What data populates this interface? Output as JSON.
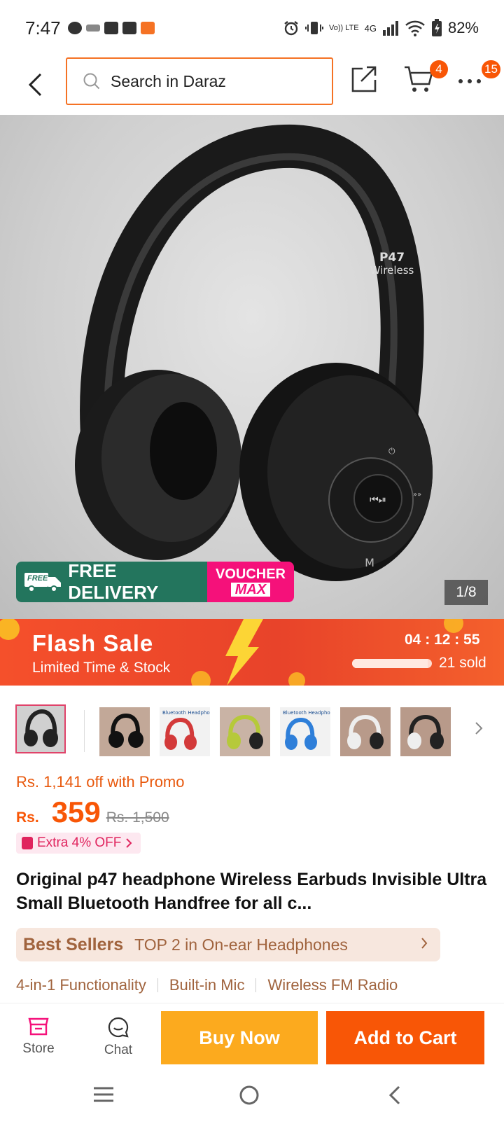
{
  "status_bar": {
    "time": "7:47",
    "network": "Vo)) LTE",
    "network_gen": "4G",
    "battery": "82%"
  },
  "header": {
    "search_placeholder": "Search in Daraz",
    "cart_count": "4",
    "more_count": "15"
  },
  "hero": {
    "headphone_brand_line1": "P47",
    "headphone_brand_line2": "Wireless",
    "free_delivery_badge": "FREE",
    "free_delivery": "FREE DELIVERY",
    "voucher": "VOUCHER",
    "voucher_max": "MAX",
    "image_counter": "1/8"
  },
  "flash_sale": {
    "title": "Flash Sale",
    "subtitle": "Limited Time & Stock",
    "timer": "04 : 12 : 55",
    "sold": "21 sold",
    "progress": 0.95
  },
  "thumbnails": [
    {
      "name": "thumb-black-1",
      "color": "#2a2a2a"
    },
    {
      "name": "thumb-black-2",
      "color": "#3a2a25"
    },
    {
      "name": "thumb-red",
      "color": "#d33a3a"
    },
    {
      "name": "thumb-lime",
      "color": "#b6c93a"
    },
    {
      "name": "thumb-blue",
      "color": "#2f7fd9"
    },
    {
      "name": "thumb-white-black",
      "color": "#c9b8ac"
    },
    {
      "name": "thumb-black-3",
      "color": "#9a7f70"
    }
  ],
  "thumbnail_caption": "Bluetooth Headphone",
  "price": {
    "promo_off": "Rs. 1,141 off with Promo",
    "currency": "Rs.",
    "value": "359",
    "original": "Rs. 1,500",
    "extra_off": "Extra 4% OFF"
  },
  "product": {
    "title": "Original p47 headphone Wireless Earbuds Invisible Ultra Small Bluetooth Handfree for all c..."
  },
  "best_sellers": {
    "label": "Best Sellers",
    "text": "TOP 2 in On-ear Headphones"
  },
  "features": [
    "4-in-1 Functionality",
    "Built-in Mic",
    "Wireless FM Radio"
  ],
  "actions": {
    "store": "Store",
    "chat": "Chat",
    "buy_now": "Buy Now",
    "add_to_cart": "Add to Cart"
  },
  "colors": {
    "accent_orange": "#f85606",
    "buy_now_yellow": "#fcaa1e",
    "flash_red": "#e8432a",
    "voucher_pink": "#f5117a",
    "delivery_green": "#23755d",
    "bestseller_brown": "#a0633d"
  }
}
